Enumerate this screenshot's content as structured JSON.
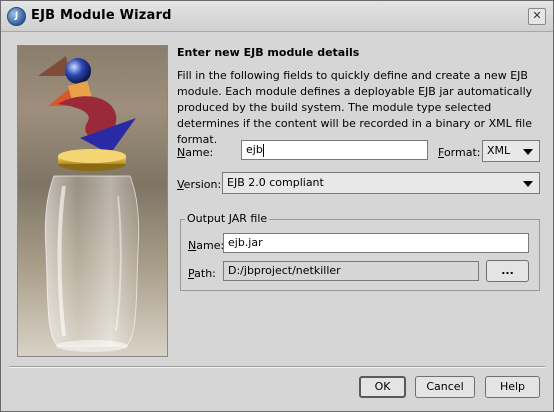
{
  "window": {
    "title": "EJB Module Wizard",
    "app_icon": "jbuilder-icon",
    "close_label": "✕"
  },
  "content": {
    "heading": "Enter new EJB module details",
    "description": "Fill in the following fields to quickly define and create a new EJB module. Each module defines a deployable EJB jar automatically produced by the build system. The module type selected determines if the content will be recorded in a binary or XML file format."
  },
  "form": {
    "name_label_mnemonic": "N",
    "name_label_rest": "ame:",
    "name_value": "ejb",
    "format_label_mnemonic": "F",
    "format_label_rest": "ormat:",
    "format_value": "XML",
    "version_label_mnemonic": "V",
    "version_label_rest": "ersion:",
    "version_value": "EJB 2.0 compliant"
  },
  "output_jar": {
    "group_title": "Output JAR file",
    "name_label_mnemonic": "N",
    "name_label_rest": "ame:",
    "name_value": "ejb.jar",
    "path_label_mnemonic": "P",
    "path_label_rest": "ath:",
    "path_value": "D:/jbproject/netkiller",
    "browse_label": "..."
  },
  "buttons": {
    "ok": "OK",
    "cancel": "Cancel",
    "help": "Help"
  }
}
